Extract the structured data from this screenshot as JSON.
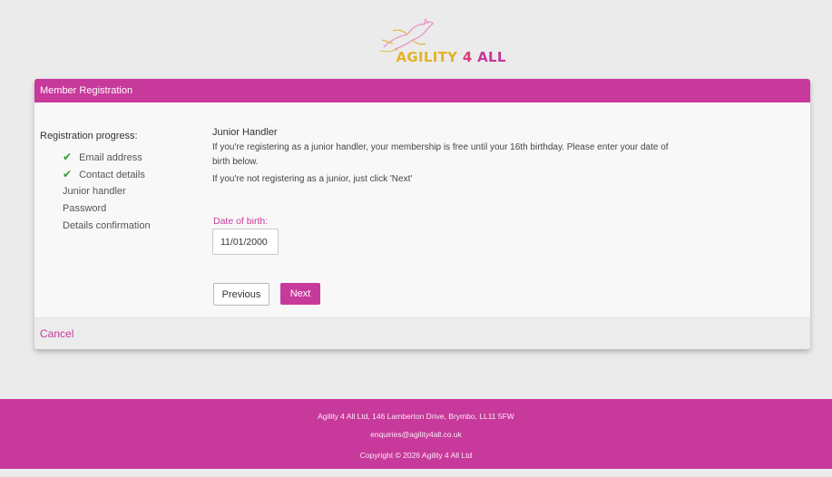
{
  "brand": {
    "logo_text_1": "AGILITY ",
    "logo_text_2": "4",
    "logo_text_3": " ALL",
    "colors": {
      "primary": "#c7399b",
      "check": "#2e9b2e"
    },
    "logo_icon": "dog-jumping-icon"
  },
  "card": {
    "header": "Member Registration",
    "cancel_label": "Cancel"
  },
  "progress": {
    "title": "Registration progress:",
    "steps": [
      {
        "label": "Email address",
        "done": true
      },
      {
        "label": "Contact details",
        "done": true
      },
      {
        "label": "Junior handler",
        "done": false
      },
      {
        "label": "Password",
        "done": false
      },
      {
        "label": "Details confirmation",
        "done": false
      }
    ]
  },
  "junior": {
    "title": "Junior Handler",
    "para1": "If you're registering as a junior handler, your membership is free until your 16th birthday. Please enter your date of birth below.",
    "para2": "If you're not registering as a junior, just click 'Next'",
    "dob_label": "Date of birth:",
    "dob_value": "11/01/2000",
    "prev_label": "Previous",
    "next_label": "Next"
  },
  "footer": {
    "address": "Agility 4 All Ltd, 146 Lamberton Drive, Brymbo, LL11 5FW",
    "email": "enquiries@agility4all.co.uk",
    "copyright": "Copyright © 2026 Agility 4 All Ltd"
  }
}
